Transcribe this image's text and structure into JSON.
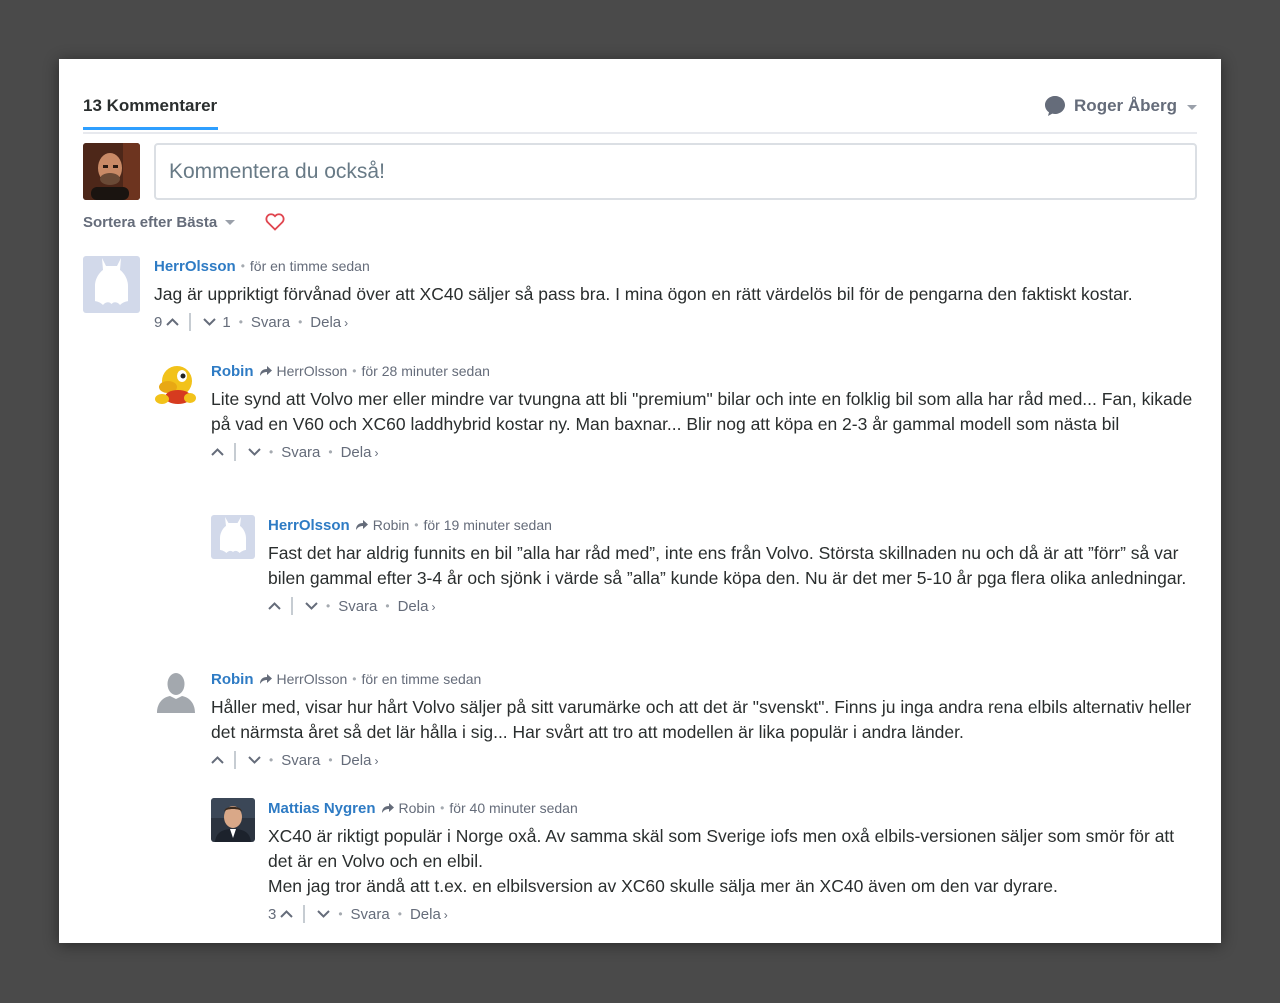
{
  "header": {
    "comment_count": "13 Kommentarer",
    "user_name": "Roger Åberg"
  },
  "composer": {
    "placeholder": "Kommentera du också!"
  },
  "sort": {
    "label": "Sortera efter Bästa"
  },
  "colors": {
    "accent": "#2e9fff",
    "author_link": "#2e7bc4",
    "muted": "#656c7a",
    "heart": "#e0454f"
  },
  "comments": [
    {
      "author": "HerrOlsson",
      "reply_to": "",
      "time": "för en timme sedan",
      "text": [
        "Jag är uppriktigt förvånad över att XC40 säljer så pass bra. I mina ögon en rätt värdelös bil för de pengarna den faktiskt kostar."
      ],
      "upvotes": "9",
      "downvotes": "1",
      "reply_label": "Svara",
      "share_label": "Dela",
      "avatar": "batman-placeholder-avatar"
    },
    {
      "author": "Robin",
      "reply_to": "HerrOlsson",
      "time": "för 28 minuter sedan",
      "text": [
        "Lite synd att Volvo mer eller mindre var tvungna att bli \"premium\" bilar och inte en folklig bil som alla har råd med... Fan, kikade på vad en V60 och XC60 laddhybrid kostar ny. Man baxnar... Blir nog att köpa en 2-3 år gammal modell som nästa bil"
      ],
      "upvotes": "",
      "downvotes": "",
      "reply_label": "Svara",
      "share_label": "Dela",
      "avatar": "mascot-avatar"
    },
    {
      "author": "HerrOlsson",
      "reply_to": "Robin",
      "time": "för 19 minuter sedan",
      "text": [
        "Fast det har aldrig funnits en bil ”alla har råd med”, inte ens från Volvo. Största skillnaden nu och då är att ”förr” så var bilen gammal efter 3-4 år och sjönk i värde så ”alla” kunde köpa den. Nu är det mer 5-10 år pga flera olika anledningar."
      ],
      "upvotes": "",
      "downvotes": "",
      "reply_label": "Svara",
      "share_label": "Dela",
      "avatar": "batman-placeholder-avatar"
    },
    {
      "author": "Robin",
      "reply_to": "HerrOlsson",
      "time": "för en timme sedan",
      "text": [
        "Håller med, visar hur hårt Volvo säljer på sitt varumärke och att det är \"svenskt\". Finns ju inga andra rena elbils alternativ heller det närmsta året så det lär hålla i sig... Har svårt att tro att modellen är lika populär i andra länder."
      ],
      "upvotes": "",
      "downvotes": "",
      "reply_label": "Svara",
      "share_label": "Dela",
      "avatar": "default-silhouette-avatar"
    },
    {
      "author": "Mattias Nygren",
      "reply_to": "Robin",
      "time": "för 40 minuter sedan",
      "text": [
        "XC40 är riktigt populär i Norge oxå. Av samma skäl som Sverige iofs men oxå elbils-versionen säljer som smör för att det är en Volvo och en elbil.",
        "Men jag tror ändå att t.ex. en elbilsversion av XC60 skulle sälja mer än XC40 även om den var dyrare."
      ],
      "upvotes": "3",
      "downvotes": "",
      "reply_label": "Svara",
      "share_label": "Dela",
      "avatar": "photo-avatar"
    }
  ]
}
